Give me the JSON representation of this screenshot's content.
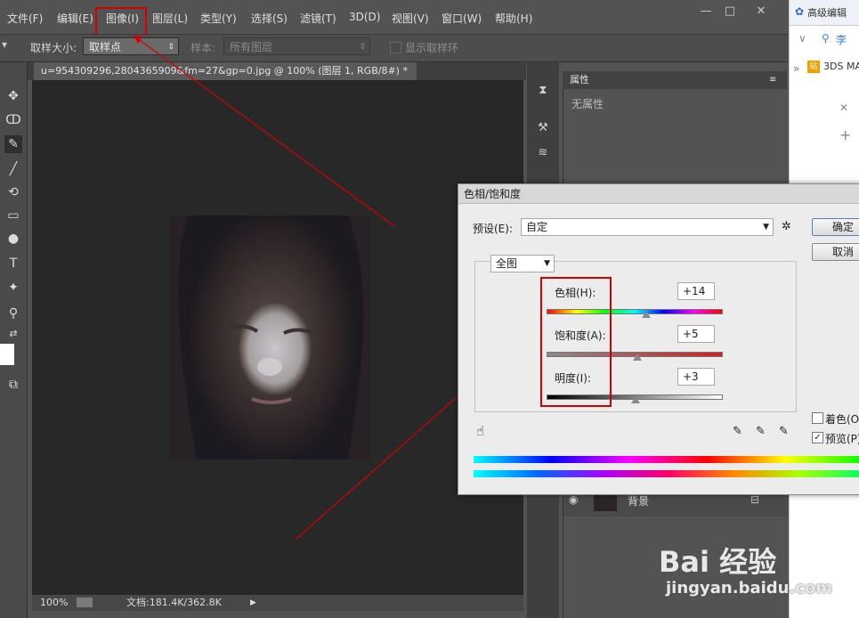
{
  "menu": [
    "文件(F)",
    "编辑(E)",
    "图像(I)",
    "图层(L)",
    "类型(Y)",
    "选择(S)",
    "滤镜(T)",
    "3D(D)",
    "视图(V)",
    "窗口(W)",
    "帮助(H)"
  ],
  "window_buttons": [
    "—",
    "□",
    "✕"
  ],
  "options": {
    "sample_size_label": "取样大小:",
    "sample_size_value": "取样点",
    "sample_label": "样本:",
    "sample_value": "所有图层",
    "show_ring_label": "显示取样环"
  },
  "document": {
    "tab_title": "u=954309296,2804365909&fm=27&gp=0.jpg @ 100% (图层 1, RGB/8#) *",
    "tab_close": "×",
    "zoom": "100%",
    "doc_info": "文档:181.4K/362.8K"
  },
  "properties": {
    "title": "属性",
    "empty_text": "无属性",
    "layer_name": "背景"
  },
  "browser": {
    "top_text": "高级编辑",
    "search_text": "李",
    "bookmark": "3DS MA"
  },
  "dialog": {
    "title": "色相/饱和度",
    "preset_label": "预设(E):",
    "preset_value": "自定",
    "ok": "确定",
    "cancel": "取消",
    "channel": "全图",
    "hue_label": "色相(H):",
    "hue_value": "+14",
    "saturation_label": "饱和度(A):",
    "saturation_value": "+5",
    "lightness_label": "明度(I):",
    "lightness_value": "+3",
    "colorize_label": "着色(O",
    "preview_label": "预览(P)",
    "hue_fraction": 0.57,
    "saturation_fraction": 0.52,
    "lightness_fraction": 0.51
  },
  "watermark": {
    "brand": "Bai  经验",
    "url": "jingyan.baidu.com"
  },
  "colors": {
    "highlight": "#d40000",
    "app_bg": "#535353",
    "canvas_bg": "#282828"
  }
}
